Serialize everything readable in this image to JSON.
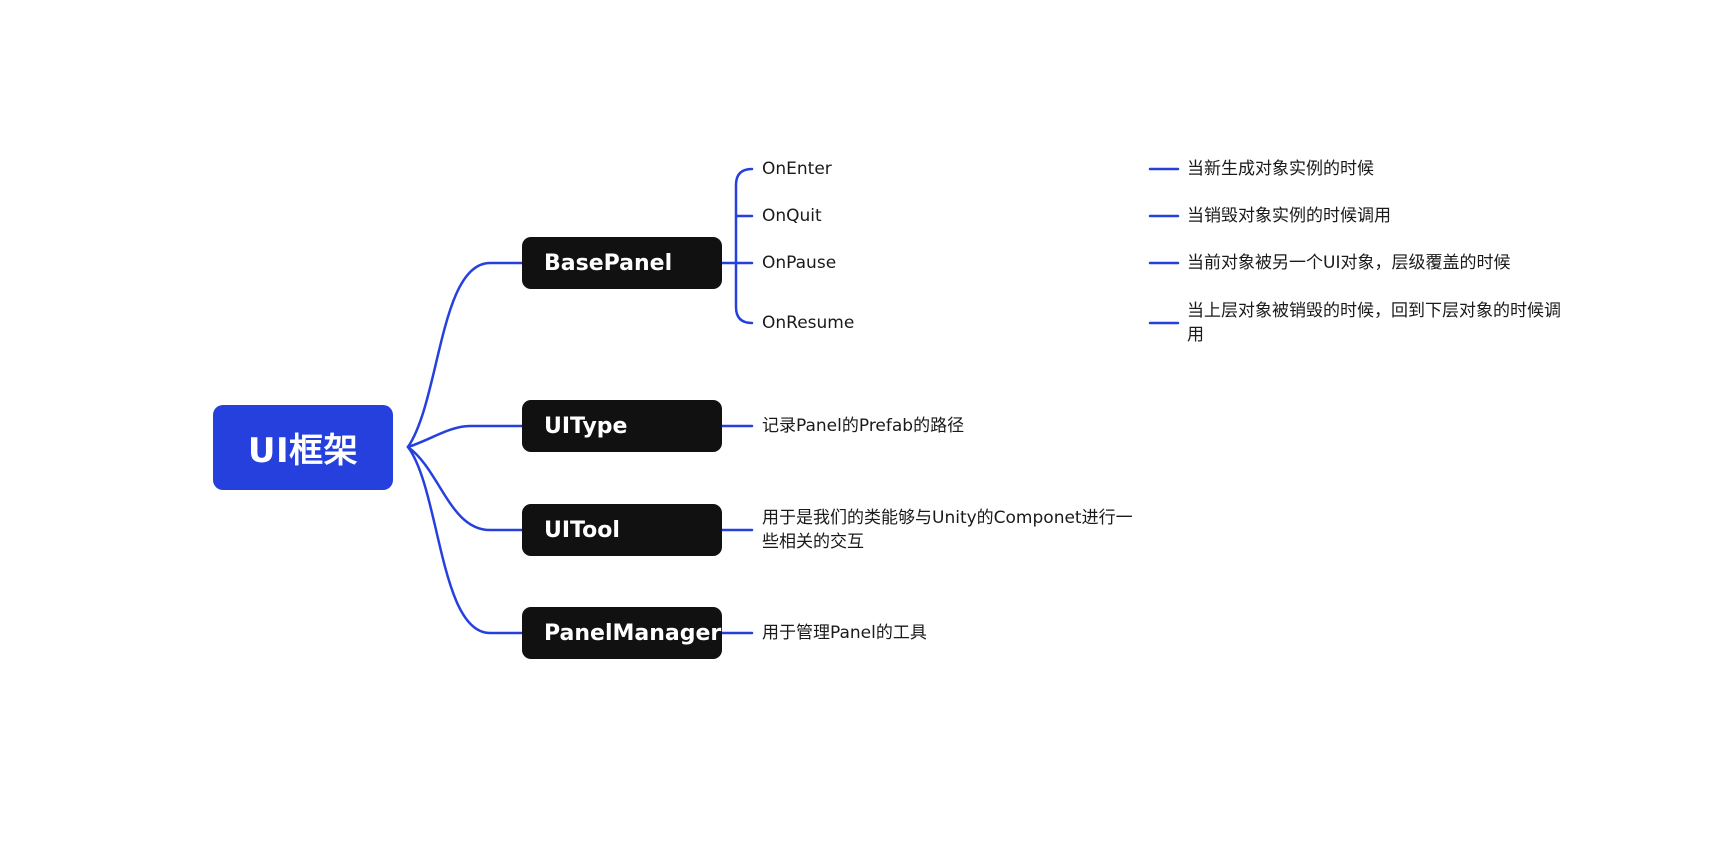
{
  "colors": {
    "root_bg": "#2640dd",
    "branch_bg": "#111111",
    "line": "#2640dd",
    "text": "#1a1a1a"
  },
  "root": {
    "label": "UI框架"
  },
  "branches": [
    {
      "label": "BasePanel",
      "children": [
        {
          "label": "OnEnter",
          "desc": "当新生成对象实例的时候"
        },
        {
          "label": "OnQuit",
          "desc": "当销毁对象实例的时候调用"
        },
        {
          "label": "OnPause",
          "desc": "当前对象被另一个UI对象，层级覆盖的时候"
        },
        {
          "label": "OnResume",
          "desc": "当上层对象被销毁的时候，回到下层对象的时候调用"
        }
      ]
    },
    {
      "label": "UIType",
      "note": "记录Panel的Prefab的路径"
    },
    {
      "label": "UITool",
      "note": "用于是我们的类能够与Unity的Componet进行一些相关的交互"
    },
    {
      "label": "PanelManager",
      "note": "用于管理Panel的工具"
    }
  ]
}
